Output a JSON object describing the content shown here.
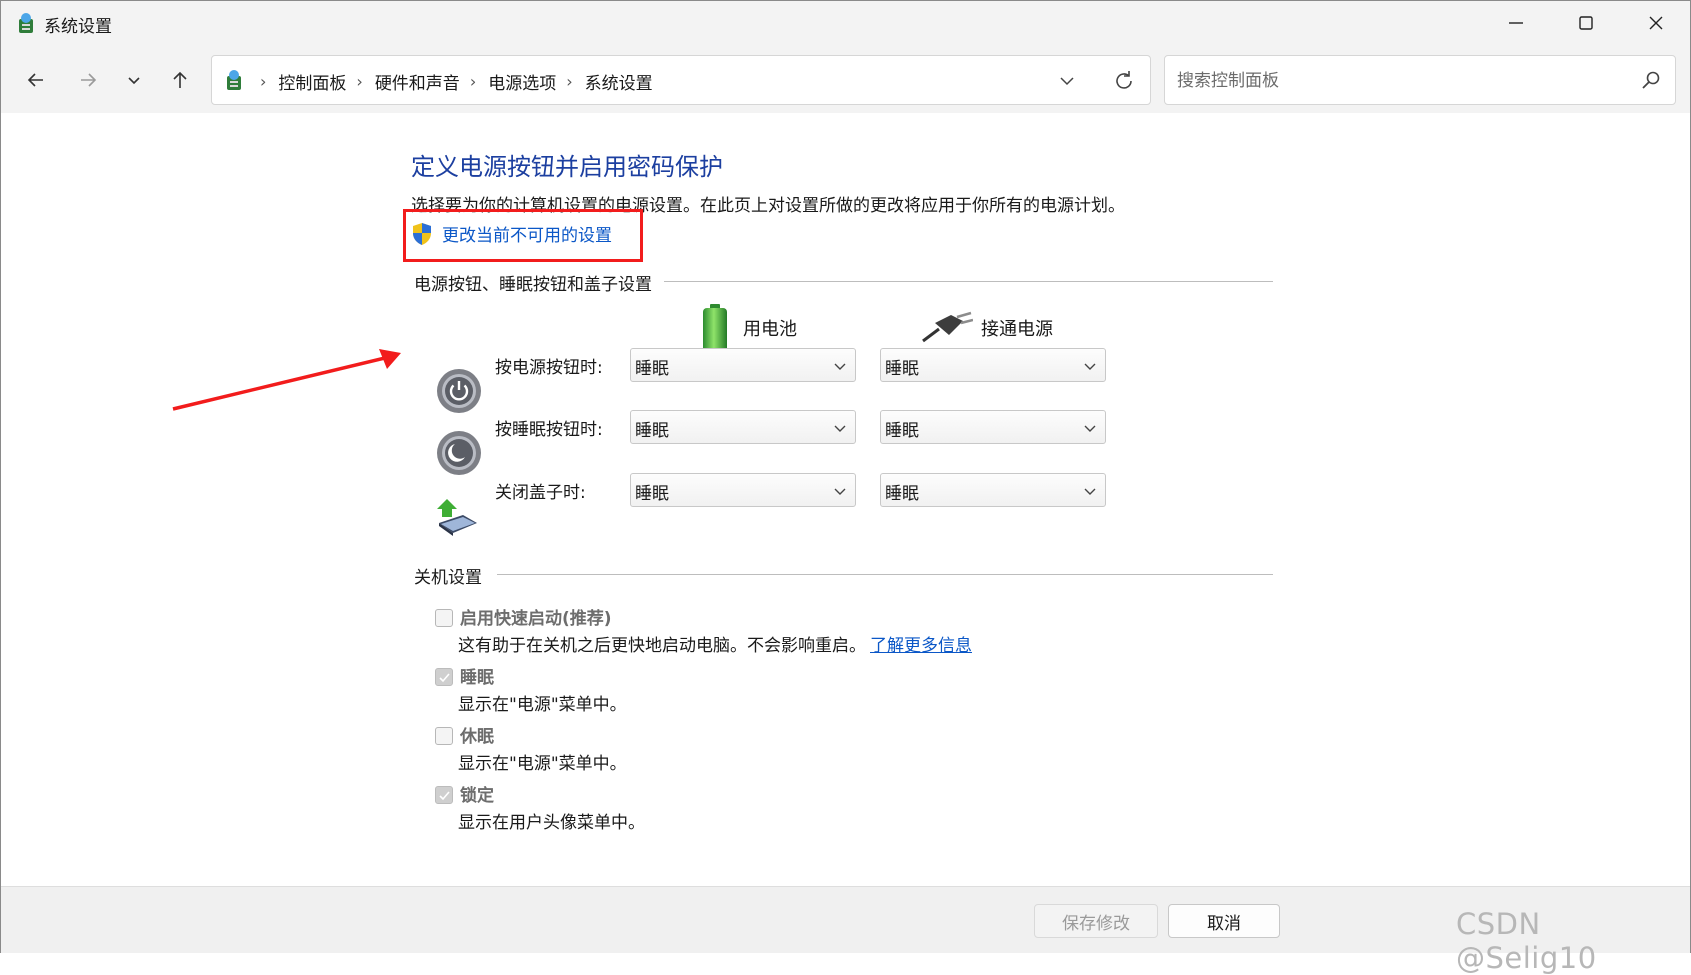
{
  "window": {
    "title": "系统设置"
  },
  "address": {
    "crumbs": [
      "控制面板",
      "硬件和声音",
      "电源选项",
      "系统设置"
    ],
    "separator": "›"
  },
  "search": {
    "placeholder": "搜索控制面板"
  },
  "main": {
    "heading": "定义电源按钮并启用密码保护",
    "description": "选择要为你的计算机设置的电源设置。在此页上对设置所做的更改将应用于你所有的电源计划。",
    "change_link": "更改当前不可用的设置",
    "power_section_title": "电源按钮、睡眠按钮和盖子设置",
    "columns": {
      "battery": "用电池",
      "plugged": "接通电源"
    },
    "rows": [
      {
        "label": "按电源按钮时:",
        "battery": "睡眠",
        "plugged": "睡眠",
        "icon": "power-button-icon"
      },
      {
        "label": "按睡眠按钮时:",
        "battery": "睡眠",
        "plugged": "睡眠",
        "icon": "sleep-button-icon"
      },
      {
        "label": "关闭盖子时:",
        "battery": "睡眠",
        "plugged": "睡眠",
        "icon": "laptop-lid-icon"
      }
    ],
    "shutdown_section_title": "关机设置",
    "shutdown_options": [
      {
        "label": "启用快速启动(推荐)",
        "desc": "这有助于在关机之后更快地启动电脑。不会影响重启。",
        "link": "了解更多信息",
        "checked": false
      },
      {
        "label": "睡眠",
        "desc": "显示在\"电源\"菜单中。",
        "checked": true
      },
      {
        "label": "休眠",
        "desc": "显示在\"电源\"菜单中。",
        "checked": false
      },
      {
        "label": "锁定",
        "desc": "显示在用户头像菜单中。",
        "checked": true
      }
    ]
  },
  "footer": {
    "save": "保存修改",
    "cancel": "取消"
  },
  "watermark": "CSDN @Selig10",
  "colors": {
    "heading": "#1c3fa0",
    "link": "#0b57c7",
    "annotation": "#f21c1c",
    "chrome": "#f3f3f3"
  }
}
